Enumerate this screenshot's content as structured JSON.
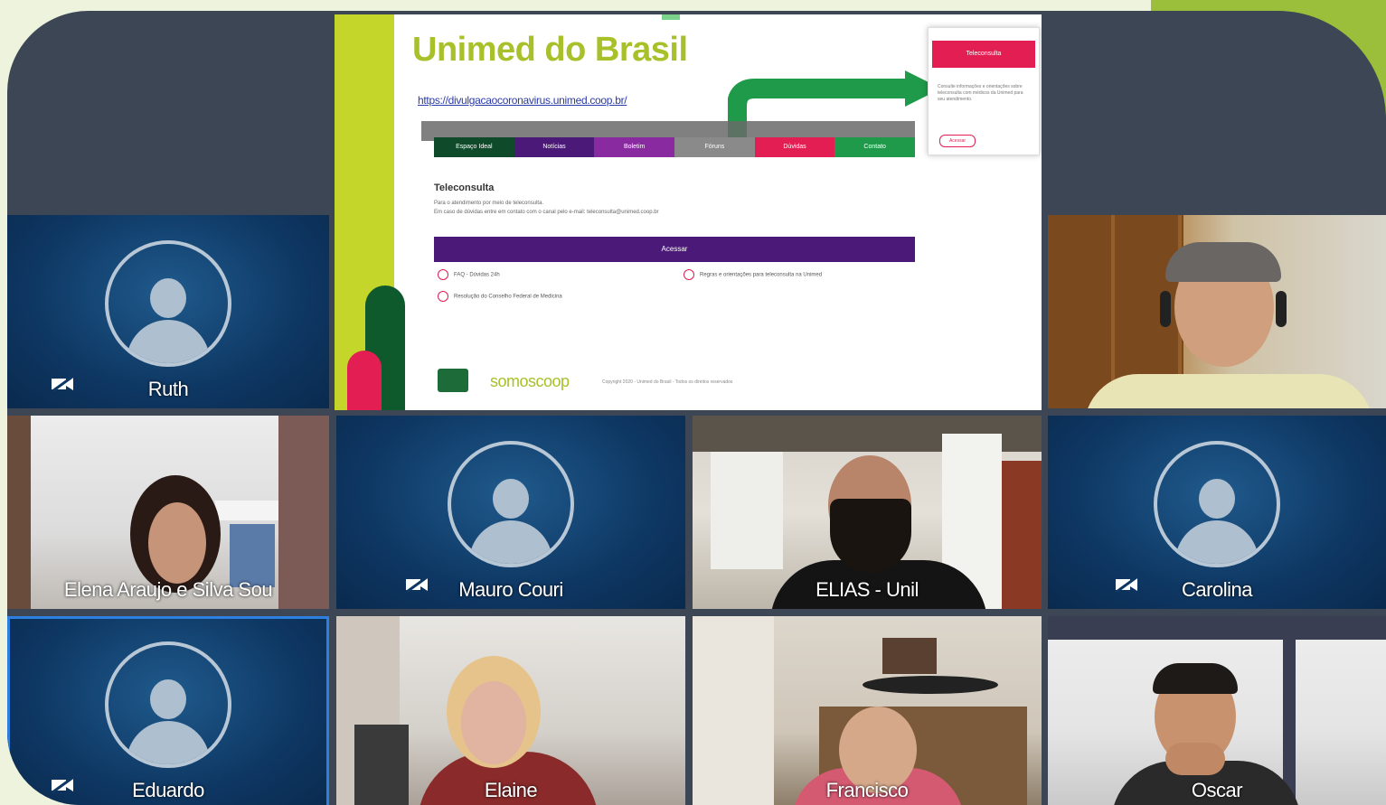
{
  "shared_screen": {
    "title": "Unimed do Brasil",
    "url": "https://divulgacaocoronavirus.unimed.coop.br/",
    "nav_items": [
      "Espaço Ideal",
      "Notícias",
      "Boletim",
      "Fóruns",
      "Dúvidas",
      "Contato"
    ],
    "nav_colors": [
      "#0f4a2a",
      "#4b1a78",
      "#8a2aa0",
      "#8a8a8a",
      "#e31e52",
      "#1f9a4a"
    ],
    "section_heading": "Teleconsulta",
    "section_line1": "Para o atendimento por meio de teleconsulta.",
    "section_line2": "Em caso de dúvidas entre em contato com o canal pelo e-mail: teleconsulta@unimed.coop.br",
    "bar_label": "Acessar",
    "option_1": "FAQ - Dúvidas 24h",
    "option_2": "Regras e orientações para teleconsulta na Unimed",
    "option_3": "Resolução do Conselho Federal de Medicina",
    "popup_header": "Teleconsulta",
    "popup_text": "Consulte informações e orientações sobre teleconsulta com médicos da Unimed para seu atendimento.",
    "popup_button": "Acessar",
    "footer_brand": "somoscoop",
    "footer_copy": "Copyright 2020 - Unimed do Brasil - Todos os direitos reservados"
  },
  "participants": {
    "ruth": "Ruth",
    "elena": "Elena Araujo e Silva Sou",
    "mauro": "Mauro Couri",
    "elias": "ELIAS - Unil",
    "carolina": "Carolina",
    "eduardo": "Eduardo",
    "elaine": "Elaine",
    "francisco": "Francisco",
    "oscar": "Oscar"
  },
  "colors": {
    "unimed_green": "#a8c02a",
    "active_speaker": "#2d7fe0",
    "tile_blue": "#0e3763"
  }
}
